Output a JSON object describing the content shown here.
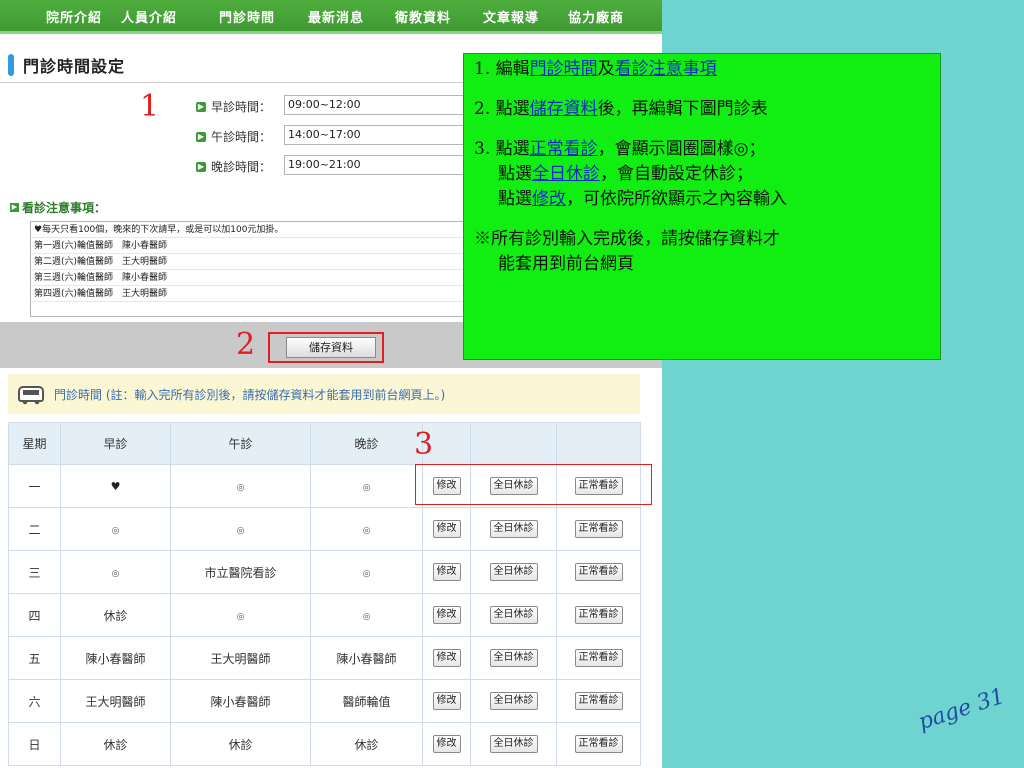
{
  "nav": {
    "items": [
      "院所介紹",
      "人員介紹",
      "門診時間",
      "最新消息",
      "衛教資料",
      "文章報導",
      "協力廠商"
    ]
  },
  "section_title": "門診時間設定",
  "markers": {
    "one": "1",
    "two": "2",
    "three": "3"
  },
  "clinic_times": [
    {
      "label": "早診時間：",
      "value": "09:00~12:00"
    },
    {
      "label": "午診時間：",
      "value": "14:00~17:00"
    },
    {
      "label": "晚診時間：",
      "value": "19:00~21:00"
    }
  ],
  "notes": {
    "label": "看診注意事項：",
    "lines": [
      "♥每天只看100個，晚來的下次請早，或是可以加100元加掛。",
      "第一週(六)輪值醫師　陳小春醫師",
      "第二週(六)輪值醫師　王大明醫師",
      "第三週(六)輪值醫師　陳小春醫師",
      "第四週(六)輪值醫師　王大明醫師"
    ]
  },
  "save_button": "儲存資料",
  "hint": "門診時間 (註：輸入完所有診別後，請按儲存資料才能套用到前台網頁上。)",
  "table": {
    "headers": [
      "星期",
      "早診",
      "午診",
      "晚診",
      "",
      "",
      ""
    ],
    "action_labels": {
      "edit": "修改",
      "closed": "全日休診",
      "normal": "正常看診"
    },
    "rows": [
      {
        "day": "一",
        "morning": "♥",
        "afternoon": "◎",
        "evening": "◎"
      },
      {
        "day": "二",
        "morning": "◎",
        "afternoon": "◎",
        "evening": "◎"
      },
      {
        "day": "三",
        "morning": "◎",
        "afternoon": "市立醫院看診",
        "evening": "◎"
      },
      {
        "day": "四",
        "morning": "休診",
        "afternoon": "◎",
        "evening": "◎"
      },
      {
        "day": "五",
        "morning": "陳小春醫師",
        "afternoon": "王大明醫師",
        "evening": "陳小春醫師"
      },
      {
        "day": "六",
        "morning": "王大明醫師",
        "afternoon": "陳小春醫師",
        "evening": "醫師輪值"
      },
      {
        "day": "日",
        "morning": "休診",
        "afternoon": "休診",
        "evening": "休診"
      }
    ]
  },
  "instructions": {
    "s1_a": "1. 編輯",
    "s1_u1": "門診時間",
    "s1_b": "及",
    "s1_u2": "看診注意事項",
    "s2_a": "2. 點選",
    "s2_u1": "儲存資料",
    "s2_b": "後，再編輯下圖門診表",
    "s3_a": "3. 點選",
    "s3_u1": "正常看診",
    "s3_b": "，會顯示圓圈圖樣◎；",
    "s3_c": "點選",
    "s3_u2": "全日休診",
    "s3_d": "，會自動設定休診；",
    "s3_e": "點選",
    "s3_u3": "修改",
    "s3_f": "，可依院所欲顯示之內容輸入",
    "note_1": "※所有診別輸入完成後，請按儲存資料才",
    "note_2": "能套用到前台網頁"
  },
  "page_number": "page 31"
}
